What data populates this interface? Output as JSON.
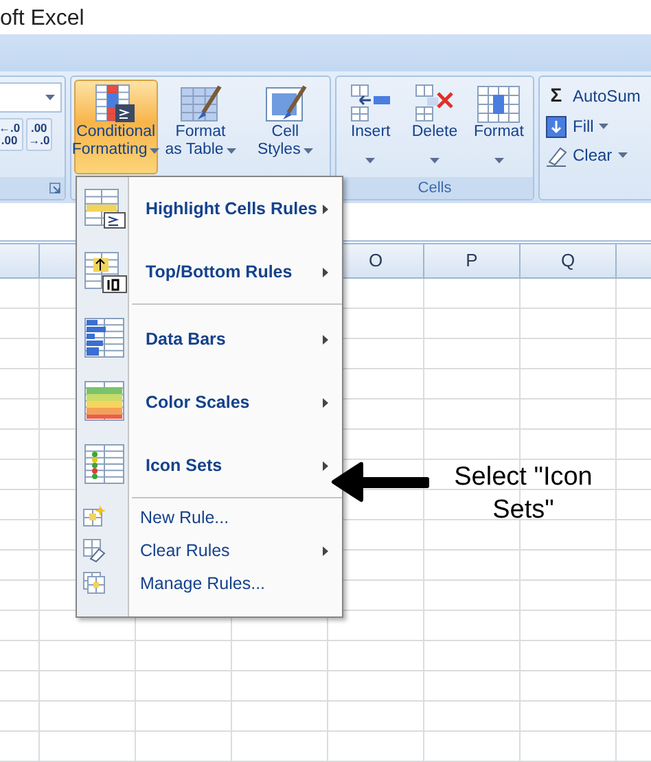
{
  "window": {
    "title": "oft Excel"
  },
  "ribbon": {
    "groups": [
      {
        "kind": "number",
        "decimal_buttons": [
          {
            "top": "←.0",
            "bottom": ".00"
          },
          {
            "top": ".00",
            "bottom": "→.0"
          }
        ]
      },
      {
        "kind": "large",
        "buttons": [
          {
            "lines": [
              "Conditional",
              "Formatting"
            ],
            "dropdown": true,
            "selected": true
          },
          {
            "lines": [
              "Format",
              "as Table"
            ],
            "dropdown": true,
            "selected": false
          },
          {
            "lines": [
              "Cell",
              "Styles"
            ],
            "dropdown": true,
            "selected": false
          }
        ]
      },
      {
        "kind": "large",
        "label": "Cells",
        "buttons": [
          {
            "lines": [
              "Insert"
            ],
            "dropdown": true,
            "selected": false
          },
          {
            "lines": [
              "Delete"
            ],
            "dropdown": true,
            "selected": false
          },
          {
            "lines": [
              "Format"
            ],
            "dropdown": true,
            "selected": false
          }
        ]
      },
      {
        "kind": "small",
        "buttons": [
          {
            "glyph": "Σ",
            "label": "AutoSum",
            "dropdown": false
          },
          {
            "label": "Fill",
            "dropdown": true
          },
          {
            "label": "Clear",
            "dropdown": true
          }
        ]
      }
    ]
  },
  "sheet": {
    "column_headers": [
      "O",
      "P",
      "Q"
    ]
  },
  "menu": {
    "items": [
      {
        "kind": "large",
        "label": "Highlight Cells Rules",
        "submenu": true,
        "separator_before": false
      },
      {
        "kind": "large",
        "label": "Top/Bottom Rules",
        "submenu": true,
        "separator_before": false
      },
      {
        "kind": "large",
        "label": "Data Bars",
        "submenu": true,
        "separator_before": true
      },
      {
        "kind": "large",
        "label": "Color Scales",
        "submenu": true,
        "separator_before": false
      },
      {
        "kind": "large",
        "label": "Icon Sets",
        "submenu": true,
        "separator_before": false
      },
      {
        "kind": "small",
        "label": "New Rule...",
        "submenu": false,
        "separator_before": true
      },
      {
        "kind": "small",
        "label": "Clear Rules",
        "submenu": true,
        "separator_before": false
      },
      {
        "kind": "small",
        "label": "Manage Rules...",
        "submenu": false,
        "separator_before": false
      }
    ]
  },
  "annotation": {
    "text": "Select \"Icon Sets\""
  }
}
